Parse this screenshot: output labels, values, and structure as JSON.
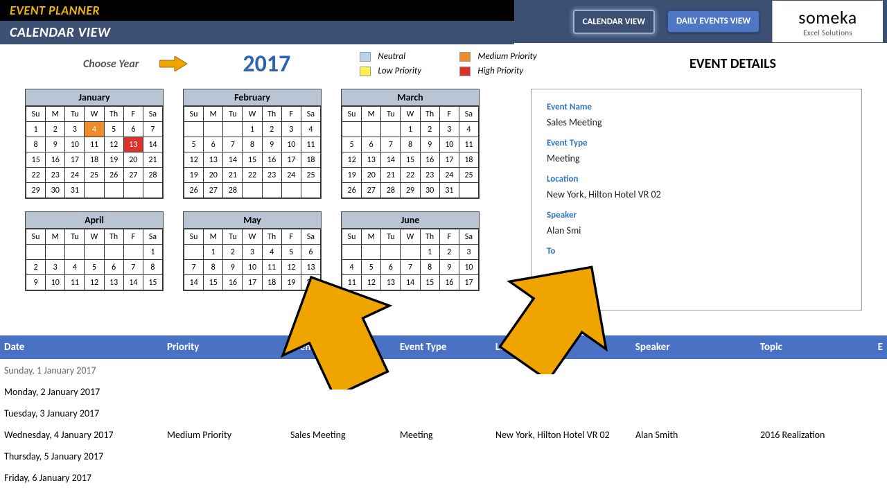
{
  "header": {
    "title1": "EVENT PLANNER",
    "title2": "CALENDAR VIEW",
    "btn_calendar": "CALENDAR VIEW",
    "btn_daily": "DAILY EVENTS VIEW",
    "logo_main": "someka",
    "logo_sub": "Excel Solutions"
  },
  "toolbar": {
    "choose_year_label": "Choose Year",
    "year": "2017",
    "legend": {
      "neutral": "Neutral",
      "low": "Low Priority",
      "medium": "Medium Priority",
      "high": "High Priority"
    },
    "details_title": "EVENT DETAILS"
  },
  "months": [
    "January",
    "February",
    "March",
    "April",
    "May",
    "June"
  ],
  "dow": [
    "Su",
    "M",
    "Tu",
    "W",
    "Th",
    "F",
    "Sa"
  ],
  "calendar": {
    "January": {
      "start": 0,
      "days": 31,
      "marks": {
        "4": "med",
        "13": "high"
      }
    },
    "February": {
      "start": 3,
      "days": 28,
      "marks": {}
    },
    "March": {
      "start": 3,
      "days": 31,
      "marks": {}
    },
    "April": {
      "start": 6,
      "days": 30,
      "marks": {},
      "cut": 15
    },
    "May": {
      "start": 1,
      "days": 31,
      "marks": {},
      "cut": 20
    },
    "June": {
      "start": 4,
      "days": 30,
      "marks": {},
      "cut": 17
    }
  },
  "details": {
    "labels": {
      "name": "Event Name",
      "type": "Event Type",
      "location": "Location",
      "speaker": "Speaker",
      "topic": "To"
    },
    "name": "Sales Meeting",
    "type": "Meeting",
    "location": "New York, Hilton Hotel VR 02",
    "speaker": "Alan Smi"
  },
  "columns": {
    "date": "Date",
    "priority": "Priority",
    "event_name": "Event Nam",
    "event_type": "Event Type",
    "location": "Locati",
    "speaker": "Speaker",
    "topic": "Topic",
    "extra": "E"
  },
  "rows": [
    {
      "date": "Sunday, 1 January 2017",
      "grey": true
    },
    {
      "date": "Monday, 2 January 2017"
    },
    {
      "date": "Tuesday, 3 January 2017"
    },
    {
      "date": "Wednesday, 4 January 2017",
      "priority": "Medium Priority",
      "event_name": "Sales Meeting",
      "event_type": "Meeting",
      "location": "New York, Hilton Hotel VR 02",
      "speaker": "Alan Smith",
      "topic": "2016 Realization"
    },
    {
      "date": "Thursday, 5 January 2017"
    },
    {
      "date": "Friday, 6 January 2017"
    }
  ]
}
